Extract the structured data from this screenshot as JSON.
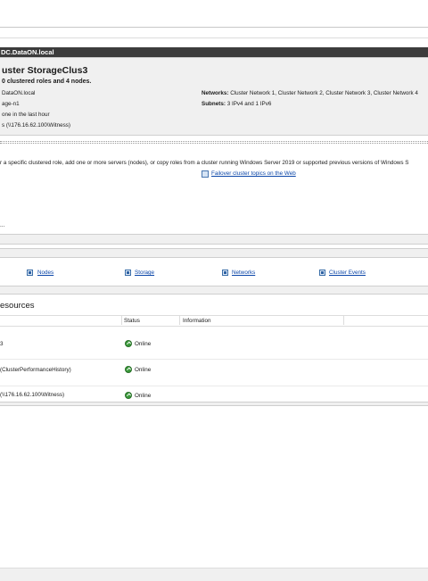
{
  "header": {
    "cluster_host": "DC.DataON.local"
  },
  "summary": {
    "title": "uster StorageClus3",
    "subtitle": "0 clustered roles and 4 nodes.",
    "domain": "DataON.local",
    "node": "age-n1",
    "events": "one in the last hour",
    "witness": "s (\\\\176.16.62.100\\Witness)",
    "networks_label": "Networks:",
    "networks_value": "Cluster Network 1, Cluster Network 2, Cluster Network 3, Cluster Network 4",
    "subnets_label": "Subnets:",
    "subnets_value": "3 IPv4 and 1 IPv6"
  },
  "configure": {
    "text": "r a specific clustered role, add one or more servers (nodes), or copy roles from a cluster running Windows Server 2019 or supported previous versions of Windows S",
    "web_link": "Failover cluster topics on the Web",
    "ellipsis": "..."
  },
  "navigate": {
    "links": [
      {
        "label": "Nodes",
        "icon": "nodes-icon"
      },
      {
        "label": "Storage",
        "icon": "storage-icon"
      },
      {
        "label": "Networks",
        "icon": "networks-icon"
      },
      {
        "label": "Cluster Events",
        "icon": "cluster-events-icon"
      }
    ]
  },
  "resources": {
    "title": "esources",
    "columns": {
      "status": "Status",
      "information": "Information"
    },
    "rows": [
      {
        "name": "3",
        "status": "Online"
      },
      {
        "name": "(ClusterPerformanceHistory)",
        "status": "Online"
      },
      {
        "name": "(\\\\176.16.62.100\\Witness)",
        "status": "Online"
      }
    ]
  },
  "colors": {
    "dark_header": "#3c3c3c",
    "panel": "#f0f0f0",
    "link": "#0b46a8",
    "online": "#3a9a3a"
  }
}
